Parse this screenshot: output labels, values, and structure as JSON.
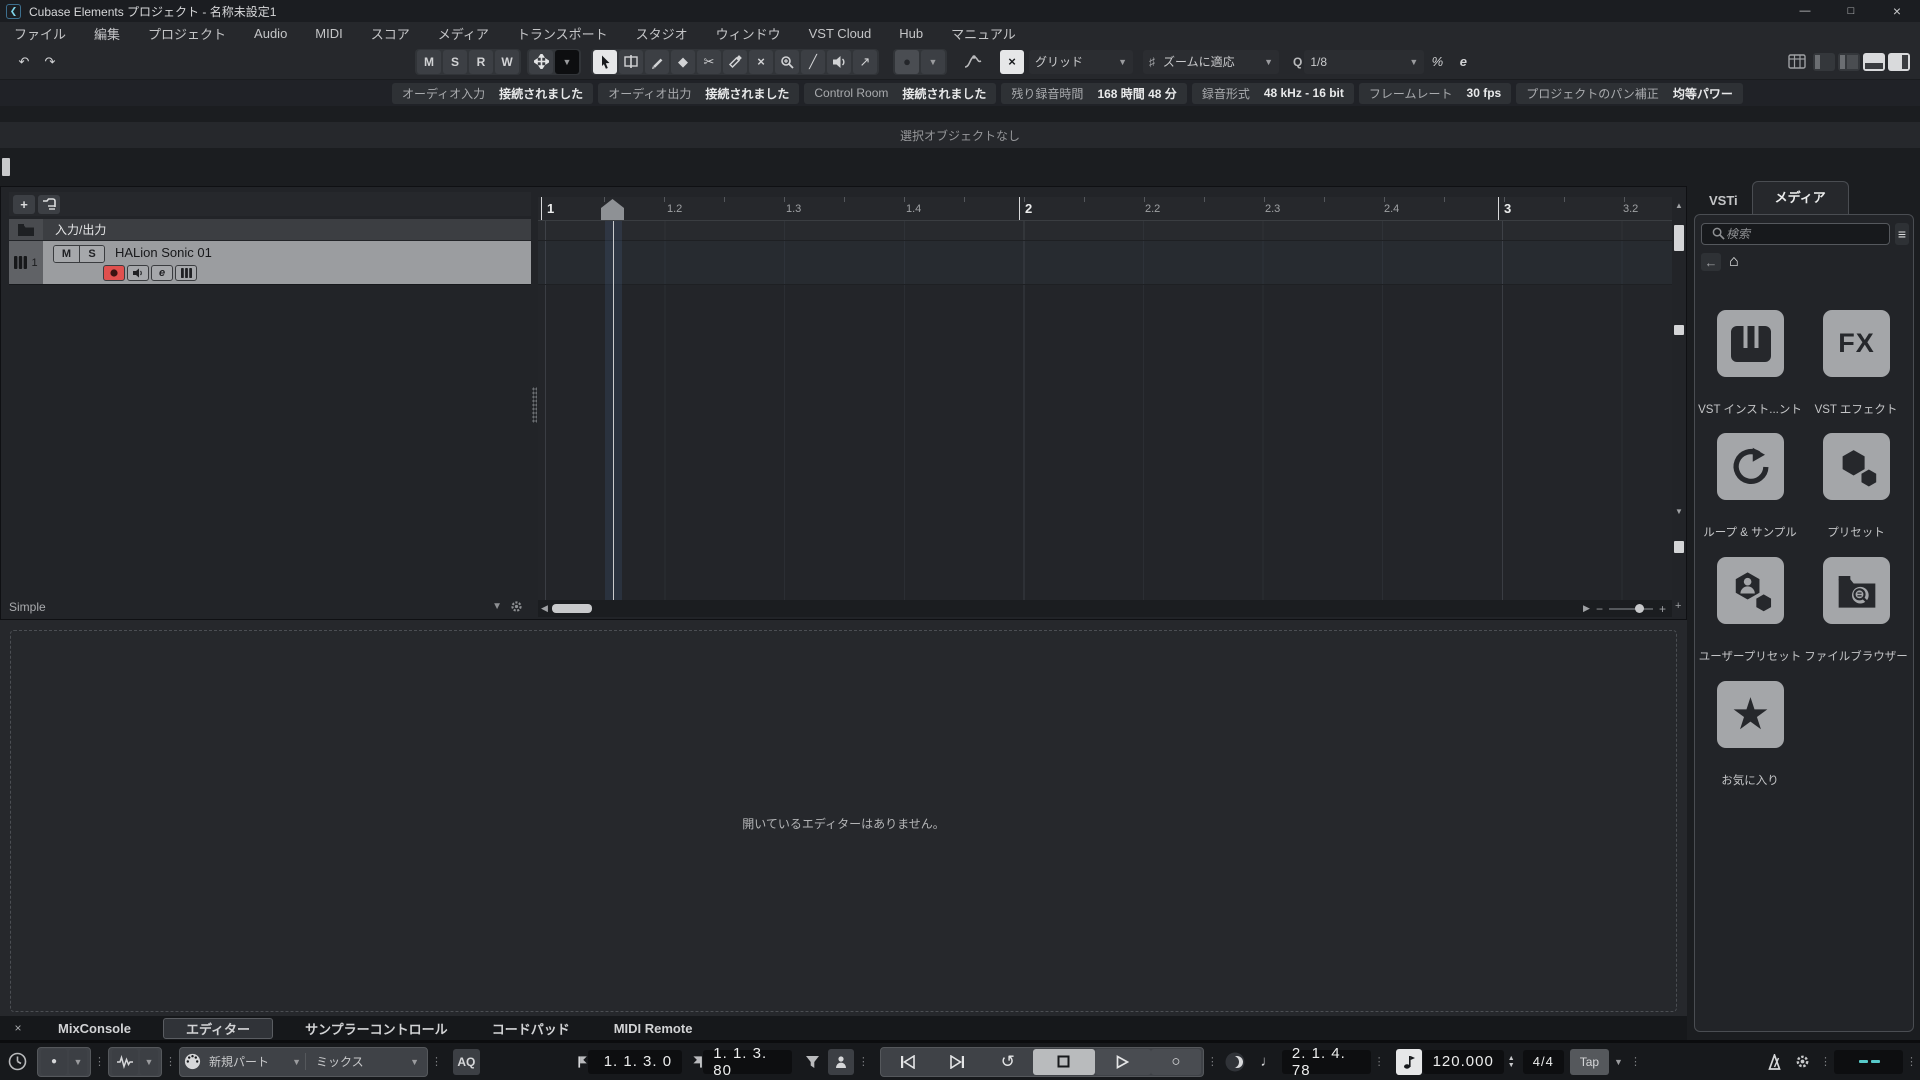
{
  "titlebar": {
    "title": "Cubase Elements プロジェクト - 名称未設定1"
  },
  "menubar": {
    "items": [
      "ファイル",
      "編集",
      "プロジェクト",
      "Audio",
      "MIDI",
      "スコア",
      "メディア",
      "トランスポート",
      "スタジオ",
      "ウィンドウ",
      "VST Cloud",
      "Hub",
      "マニュアル"
    ]
  },
  "toolbar": {
    "automation": {
      "m": "M",
      "s": "S",
      "r": "R",
      "w": "W"
    },
    "grid_type": "グリッド",
    "grid_mode": "ズームに適応",
    "quantize_q": "Q",
    "quantize_value": "1/8",
    "swing_label": "%",
    "editor_label": "e"
  },
  "infobar": {
    "chips": [
      {
        "label": "オーディオ入力",
        "value": "接続されました"
      },
      {
        "label": "オーディオ出力",
        "value": "接続されました"
      },
      {
        "label": "Control Room",
        "value": "接続されました"
      },
      {
        "label": "残り録音時間",
        "value": "168 時間 48 分"
      },
      {
        "label": "録音形式",
        "value": "48 kHz - 16 bit"
      },
      {
        "label": "フレームレート",
        "value": "30 fps"
      },
      {
        "label": "プロジェクトのパン補正",
        "value": "均等パワー"
      }
    ]
  },
  "status_line": {
    "text": "選択オブジェクトなし"
  },
  "track_panel": {
    "io_label": "入力/出力",
    "track_number": "1",
    "mute_label": "M",
    "solo_label": "S",
    "track_name": "HALion Sonic 01",
    "edit_label": "e",
    "preset_name": "Simple"
  },
  "ruler": {
    "ticks": [
      {
        "label": "1"
      },
      {
        "label": "1.2"
      },
      {
        "label": "1.3"
      },
      {
        "label": "1.4"
      },
      {
        "label": "2"
      },
      {
        "label": "2.2"
      },
      {
        "label": "2.3"
      },
      {
        "label": "2.4"
      },
      {
        "label": "3"
      },
      {
        "label": "3.2"
      }
    ]
  },
  "lower_zone": {
    "message": "開いているエディターはありません。",
    "tabs": [
      {
        "label": "MixConsole"
      },
      {
        "label": "エディター"
      },
      {
        "label": "サンプラーコントロール"
      },
      {
        "label": "コードパッド"
      },
      {
        "label": "MIDI Remote"
      }
    ],
    "active_tab": "エディター"
  },
  "right_zone": {
    "tabs": [
      {
        "label": "VSTi"
      },
      {
        "label": "メディア"
      }
    ],
    "active_tab": "メディア",
    "search_placeholder": "検索",
    "tiles": [
      {
        "label": "VST インスト...ント"
      },
      {
        "label": "VST エフェクト",
        "badge": "FX"
      },
      {
        "label": "ループ & サンプル"
      },
      {
        "label": "プリセット"
      },
      {
        "label": "ユーザープリセット"
      },
      {
        "label": "ファイルブラウザー"
      },
      {
        "label": "お気に入り"
      }
    ]
  },
  "transport": {
    "midi_record_mode": "新規パート",
    "midi_cycle_mode": "ミックス",
    "aq_label": "AQ",
    "punch_left_time": "1. 1. 3.   0",
    "punch_right_time": "1. 1. 3.  80",
    "secondary_time": "2. 1. 4. 78",
    "tempo": "120.000",
    "time_signature": "4/4",
    "tap_label": "Tap"
  },
  "colors": {
    "record_red": "#e0504e",
    "activity_teal": "#57c9c9",
    "selection_gray": "#9b9da0",
    "toolbar_bg": "#26282c"
  },
  "icons": {
    "undo": "↶",
    "redo": "↷",
    "caret_down": "▼",
    "left": "◀",
    "right": "▶",
    "up": "▲",
    "down": "▼",
    "plus": "+",
    "minus": "−",
    "ellipsis": "⋮",
    "star": "★",
    "home": "⌂",
    "back": "←",
    "list": "≡",
    "close": "×",
    "win_min": "—",
    "win_max": "□",
    "win_close": "×",
    "logo_mark": "❮",
    "line_tool": "╱",
    "eraser_tool": "◆",
    "scissors_tool": "✂",
    "mute_tool": "×",
    "color_dot": "●",
    "comp_tool": "↗",
    "snap_x": "×",
    "sharp": "♯",
    "note": "♩",
    "cycle": "↺",
    "play": "▶",
    "stop": "■",
    "record": "○",
    "grip": "⋮⋮"
  }
}
